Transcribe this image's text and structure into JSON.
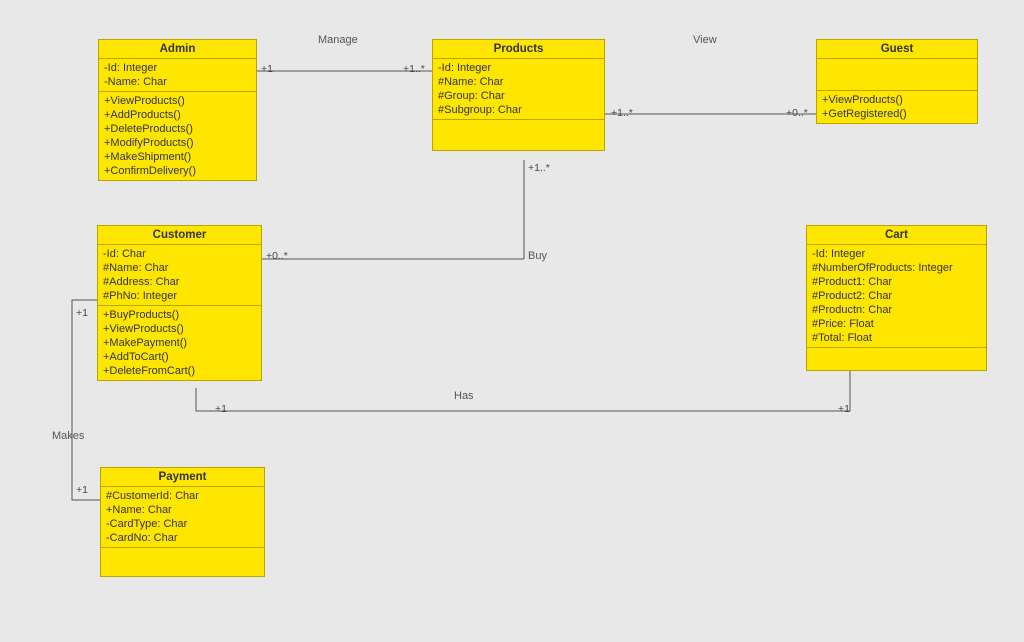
{
  "classes": {
    "admin": {
      "title": "Admin",
      "attrs": [
        "-Id: Integer",
        "-Name: Char"
      ],
      "ops": [
        "+ViewProducts()",
        "+AddProducts()",
        "+DeleteProducts()",
        "+ModifyProducts()",
        "+MakeShipment()",
        "+ConfirmDelivery()"
      ]
    },
    "products": {
      "title": "Products",
      "attrs": [
        "-Id: Integer",
        "#Name: Char",
        "#Group: Char",
        "#Subgroup: Char"
      ],
      "ops": []
    },
    "guest": {
      "title": "Guest",
      "attrs": [],
      "ops": [
        "+ViewProducts()",
        "+GetRegistered()"
      ]
    },
    "customer": {
      "title": "Customer",
      "attrs": [
        "-Id: Char",
        "#Name: Char",
        "#Address: Char",
        "#PhNo: Integer"
      ],
      "ops": [
        "+BuyProducts()",
        "+ViewProducts()",
        "+MakePayment()",
        "+AddToCart()",
        "+DeleteFromCart()"
      ]
    },
    "cart": {
      "title": "Cart",
      "attrs": [
        "-Id: Integer",
        "#NumberOfProducts: Integer",
        "#Product1: Char",
        "#Product2: Char",
        "#Productn: Char",
        "#Price: Float",
        "#Total: Float"
      ],
      "ops": []
    },
    "payment": {
      "title": "Payment",
      "attrs": [
        "#CustomerId: Char",
        "+Name: Char",
        "-CardType: Char",
        "-CardNo: Char"
      ],
      "ops": []
    }
  },
  "relations": {
    "manage": {
      "label": "Manage",
      "m1": "+1",
      "m2": "+1..*"
    },
    "view": {
      "label": "View",
      "m1": "+1..*",
      "m2": "+0..*"
    },
    "buy": {
      "label": "Buy",
      "m1": "+0..*",
      "m2": "+1..*"
    },
    "has": {
      "label": "Has",
      "m1": "+1",
      "m2": "+1"
    },
    "makes": {
      "label": "Makes",
      "m1": "+1",
      "m2": "+1"
    }
  }
}
